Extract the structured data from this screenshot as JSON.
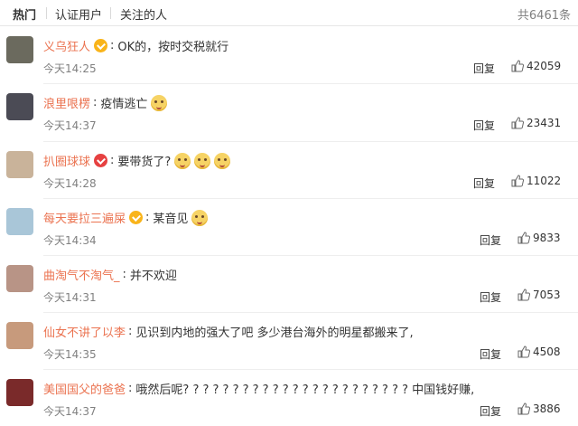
{
  "tabs": {
    "hot": "热门",
    "verified": "认证用户",
    "followed": "关注的人",
    "total": "共6461条"
  },
  "comments": [
    {
      "user": "义乌狂人",
      "badge": "orange",
      "text": "OK的，按时交税就行",
      "emojis": 0,
      "time": "今天14:25",
      "reply": "回复",
      "likes": "42059",
      "avatar": "#6b6a5e"
    },
    {
      "user": "浪里哏楞",
      "badge": "",
      "text": "疫情逃亡",
      "emojis": 1,
      "time": "今天14:37",
      "reply": "回复",
      "likes": "23431",
      "avatar": "#4b4b55"
    },
    {
      "user": "扒圈球球",
      "badge": "red",
      "text": "要带货了?",
      "emojis": 3,
      "time": "今天14:28",
      "reply": "回复",
      "likes": "11022",
      "avatar": "#c9b39a"
    },
    {
      "user": "每天要拉三遍屎",
      "badge": "orange",
      "text": "某音见",
      "emojis": 1,
      "time": "今天14:34",
      "reply": "回复",
      "likes": "9833",
      "avatar": "#a9c6d8"
    },
    {
      "user": "曲淘气不淘气_",
      "badge": "",
      "text": "并不欢迎",
      "emojis": 0,
      "time": "今天14:31",
      "reply": "回复",
      "likes": "7053",
      "avatar": "#b89486"
    },
    {
      "user": "仙女不讲了以李",
      "badge": "",
      "text": "见识到内地的强大了吧 多少港台海外的明星都搬来了,",
      "emojis": 0,
      "time": "今天14:35",
      "reply": "回复",
      "likes": "4508",
      "avatar": "#c79a7c"
    },
    {
      "user": "美国国父的爸爸",
      "badge": "",
      "text": "哦然后呢? ? ? ? ? ? ? ? ? ? ? ? ? ? ? ? ? ? ? ? ? ? ? 中国钱好赚,",
      "emojis": 0,
      "time": "今天14:37",
      "reply": "回复",
      "likes": "3886",
      "avatar": "#7a2a2a"
    }
  ]
}
